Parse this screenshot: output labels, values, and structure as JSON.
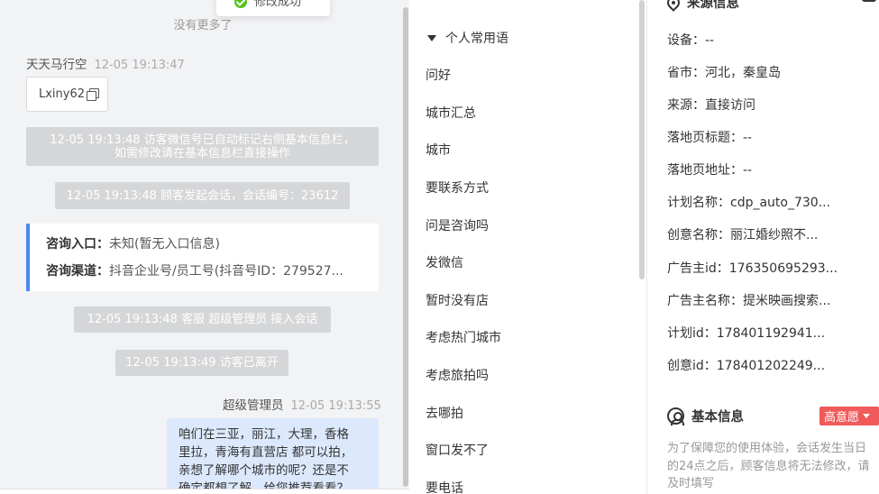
{
  "toast": {
    "text": "修改成功"
  },
  "chat": {
    "no_more": "没有更多了",
    "visitor": {
      "name": "天天马行空",
      "time": "12-05 19:13:47"
    },
    "chip": {
      "text": "Lxiny62"
    },
    "sys1": {
      "line1": "12-05 19:13:48 访客微信号已自动标记右侧基本信息栏，",
      "line2": "如需修改请在基本信息栏直接操作"
    },
    "sys2": "12-05 19:13:48 顾客发起会话，会话编号：23612",
    "card": {
      "entry_key": "咨询入口：",
      "entry_val": "未知(暂无入口信息)",
      "channel_key": "咨询渠道：",
      "channel_val": "抖音企业号/员工号(抖音号ID：279527..."
    },
    "sys3": "12-05 19:13:48 客服 超级管理员 接入会话",
    "sys4": "12-05 19:13:49 访客已离开",
    "agent": {
      "name": "超级管理员",
      "time": "12-05 19:13:55"
    },
    "bubble": {
      "line1": "咱们在三亚，丽江，大理，香格",
      "line2": "里拉，青海有直营店 都可以拍，",
      "line3": "亲想了解哪个城市的呢？还是不",
      "line4": "确定都想了解，给您推荐看看？"
    }
  },
  "phrases": {
    "header": "个人常用语",
    "items": [
      "问好",
      "城市汇总",
      "城市",
      "要联系方式",
      "问是咨询吗",
      "发微信",
      "暂时没有店",
      "考虑热门城市",
      "考虑旅拍吗",
      "去哪拍",
      "窗口发不了",
      "要电话"
    ]
  },
  "info": {
    "source_title": "来源信息",
    "fields": [
      "设备：--",
      "省市：河北，秦皇岛",
      "来源：直接访问",
      "落地页标题：--",
      "落地页地址：--",
      "计划名称：cdp_auto_730...",
      "创意名称：丽江婚纱照不...",
      "广告主id：176350695293...",
      "广告主名称：提米映画搜索...",
      "计划id：178401192941...",
      "创意id：178401202249..."
    ],
    "basic_title": "基本信息",
    "badge": "高意愿",
    "notice": "为了保障您的使用体验，会话发生当日的24点之后，顾客信息将无法修改，请及时填写"
  }
}
